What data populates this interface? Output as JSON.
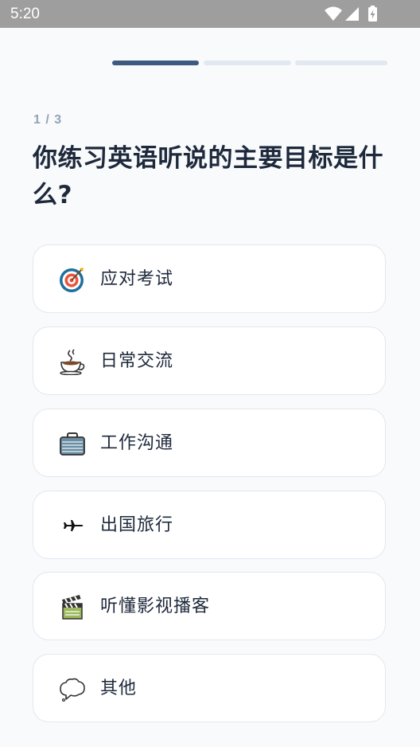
{
  "status_bar": {
    "time": "5:20",
    "icons": [
      "wifi-icon",
      "cellular-signal-icon",
      "battery-charging-icon"
    ]
  },
  "progress": {
    "current_step": 1,
    "total_steps": 3,
    "active_color": "#3d5a80",
    "inactive_color": "#e2e8f0"
  },
  "step_counter": "1 / 3",
  "question": "你练习英语听说的主要目标是什么?",
  "options": [
    {
      "label": "应对考试",
      "icon": "target-icon"
    },
    {
      "label": "日常交流",
      "icon": "coffee-cup-icon"
    },
    {
      "label": "工作沟通",
      "icon": "briefcase-icon"
    },
    {
      "label": "出国旅行",
      "icon": "airplane-icon"
    },
    {
      "label": "听懂影视播客",
      "icon": "clapperboard-icon"
    },
    {
      "label": "其他",
      "icon": "speech-bubble-icon"
    }
  ]
}
